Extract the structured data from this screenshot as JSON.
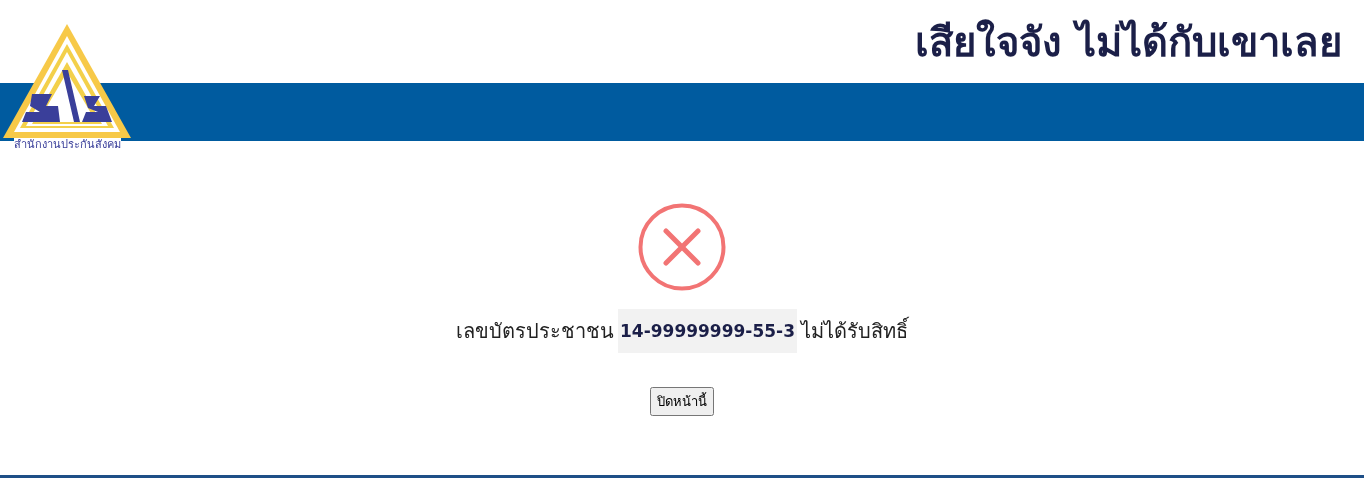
{
  "header": {
    "logo_caption": "สำนักงานประกันสังคม",
    "headline": "เสียใจจัง ไม่ได้กับเขาเลย"
  },
  "result": {
    "kind": "error",
    "prefix": "เลขบัตรประชาชน",
    "id_number": "14-99999999-55-3",
    "suffix": "ไม่ได้รับสิทธิ์"
  },
  "buttons": [
    "ปิดหน้านี้"
  ]
}
